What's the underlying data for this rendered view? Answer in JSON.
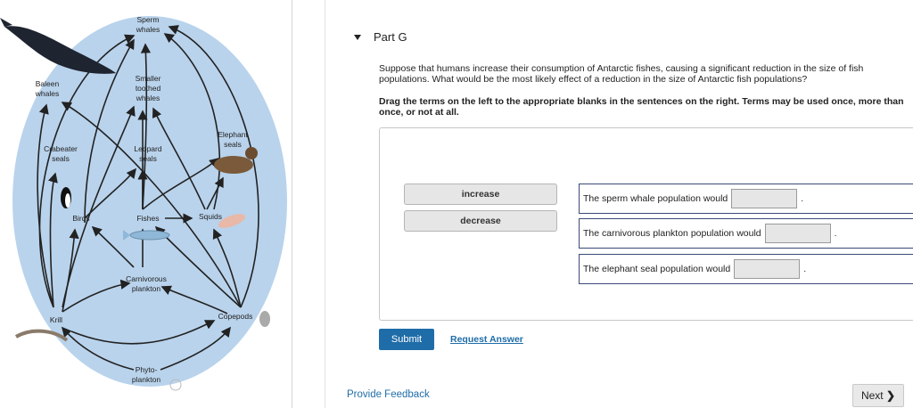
{
  "foodweb": {
    "sperm_whales_1": "Sperm",
    "sperm_whales_2": "whales",
    "baleen_whales_1": "Baleen",
    "baleen_whales_2": "whales",
    "smaller_toothed_1": "Smaller",
    "smaller_toothed_2": "toothed",
    "smaller_toothed_3": "whales",
    "elephant_seals_1": "Elephant",
    "elephant_seals_2": "seals",
    "crabeater_seals_1": "Crabeater",
    "crabeater_seals_2": "seals",
    "leopard_seals_1": "Leopard",
    "leopard_seals_2": "seals",
    "birds": "Birds",
    "fishes": "Fishes",
    "squids": "Squids",
    "carnivorous_plankton_1": "Carnivorous",
    "carnivorous_plankton_2": "plankton",
    "krill": "Krill",
    "copepods": "Copepods",
    "phytoplankton_1": "Phyto-",
    "phytoplankton_2": "plankton"
  },
  "part": {
    "title": "Part G"
  },
  "question": "Suppose that humans increase their consumption of Antarctic fishes, causing a significant reduction in the size of fish populations. What would be the most likely effect of a reduction in the size of Antarctic fish populations?",
  "instructions": "Drag the terms on the left to the appropriate blanks in the sentences on the right. Terms may be used once, more than once, or not at all.",
  "terms": [
    "increase",
    "decrease"
  ],
  "sentences": [
    "The sperm whale population would",
    "The carnivorous plankton population would",
    "The elephant seal population would"
  ],
  "sentence_end": ".",
  "buttons": {
    "submit": "Submit",
    "request_answer": "Request Answer",
    "provide_feedback": "Provide Feedback",
    "next": "Next",
    "next_icon": "chevron-right-icon"
  },
  "colors": {
    "ocean": "#b9d3ec",
    "accent_blue": "#1f6da8",
    "sentence_border": "#3a4a7a"
  }
}
